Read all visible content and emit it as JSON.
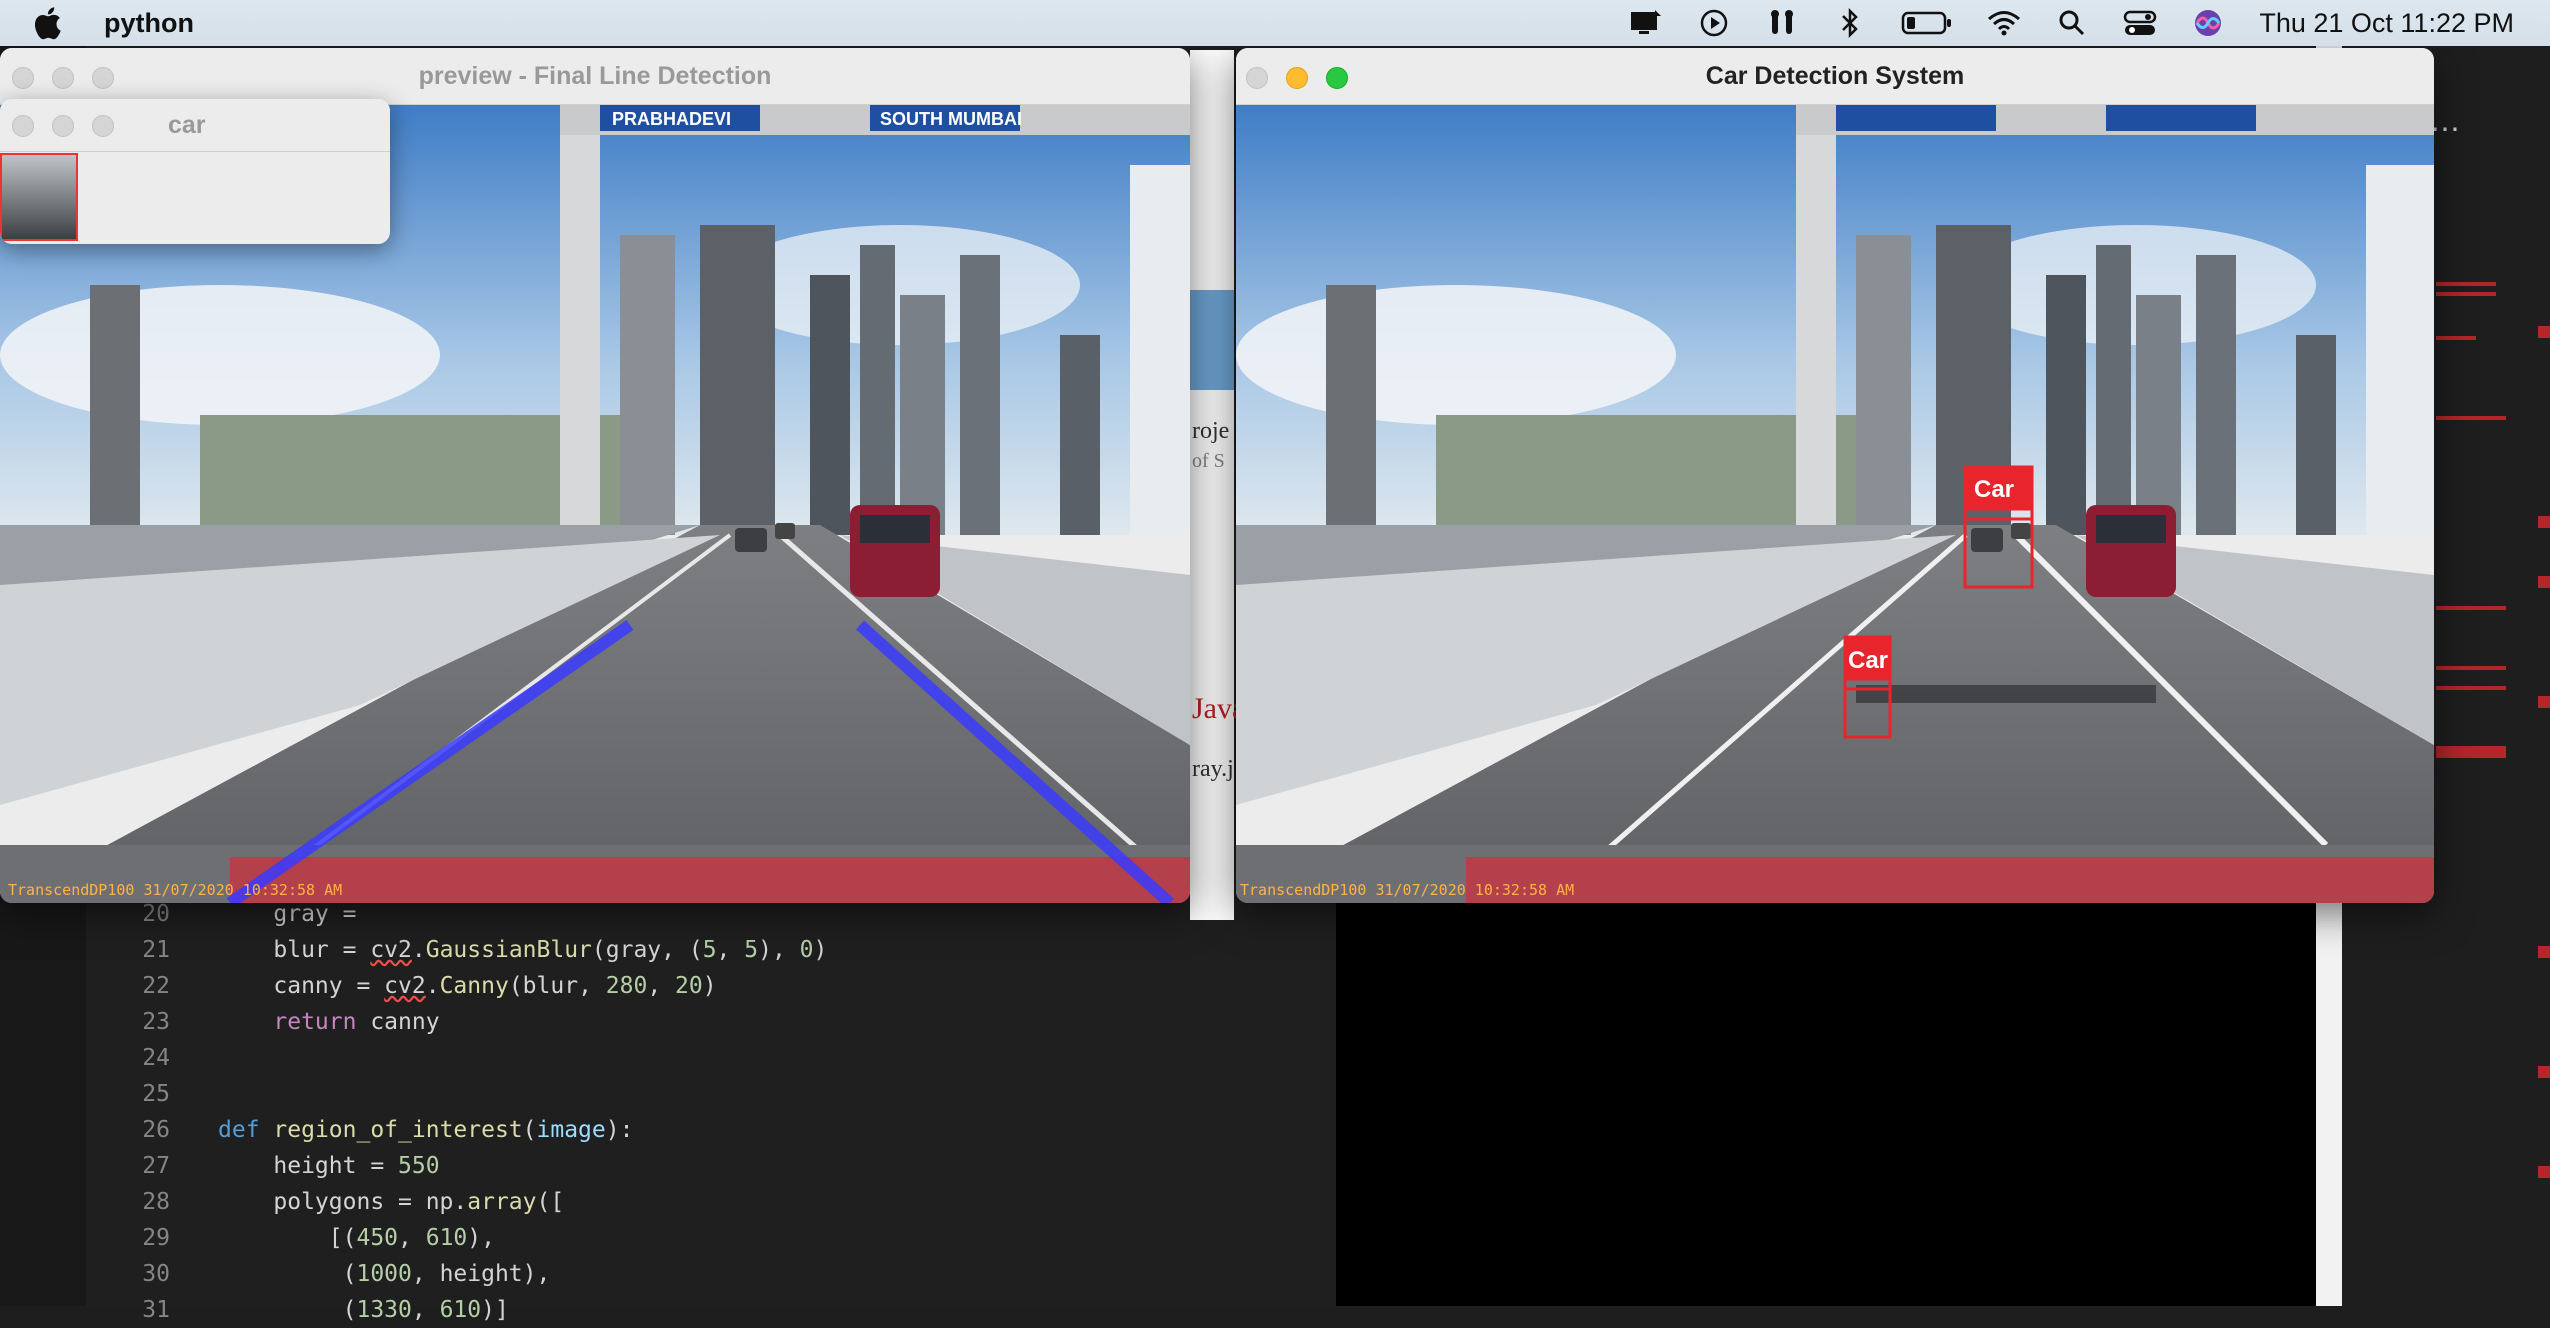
{
  "menubar": {
    "app_name": "python",
    "clock": "Thu 21 Oct  11:22 PM",
    "icons": [
      "apple-icon",
      "screen-record-icon",
      "play-icon",
      "airpods-icon",
      "bluetooth-icon",
      "battery-icon",
      "wifi-icon",
      "search-icon",
      "control-center-icon",
      "siri-icon"
    ]
  },
  "windows": {
    "preview": {
      "title": "preview - Final Line Detection",
      "timestamp": "TranscendDP100 31/07/2020 10:32:58 AM"
    },
    "car": {
      "title": "car"
    },
    "detection": {
      "title": "Car Detection System",
      "timestamp": "TranscendDP100 31/07/2020 10:32:58 AM",
      "labels": [
        "Car",
        "Car"
      ]
    },
    "signs": {
      "left": "PRABHADEVI",
      "right": "SOUTH MUMBAI"
    }
  },
  "behind_window": {
    "text1": "roje",
    "text2": "of S",
    "text3": "Java",
    "text4": "ray.j"
  },
  "editor": {
    "lines": [
      {
        "n": "20",
        "code": "    gray = "
      },
      {
        "n": "21",
        "code": "    blur = cv2.GaussianBlur(gray, (5, 5), 0)"
      },
      {
        "n": "22",
        "code": "    canny = cv2.Canny(blur, 280, 20)"
      },
      {
        "n": "23",
        "code": "    return canny"
      },
      {
        "n": "24",
        "code": ""
      },
      {
        "n": "25",
        "code": ""
      },
      {
        "n": "26",
        "code": "def region_of_interest(image):"
      },
      {
        "n": "27",
        "code": "    height = 550"
      },
      {
        "n": "28",
        "code": "    polygons = np.array(["
      },
      {
        "n": "29",
        "code": "        [(450, 610),"
      },
      {
        "n": "30",
        "code": "         (1000, height),"
      },
      {
        "n": "31",
        "code": "         (1330, 610)]"
      }
    ],
    "more_icon": "⋯"
  }
}
